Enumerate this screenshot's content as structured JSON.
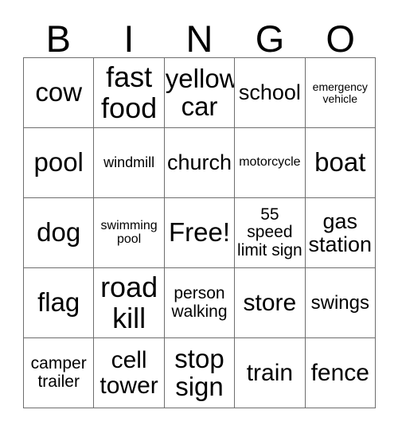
{
  "card": {
    "title": "Bingo Card",
    "headers": [
      "B",
      "I",
      "N",
      "G",
      "O"
    ],
    "colors": {
      "background": "#ffffff",
      "text": "#000000",
      "grid_line": "#6e6e6e"
    },
    "grid": {
      "columns": 5,
      "rows": 5
    },
    "cells": [
      {
        "text": "cow",
        "size": "s-4xl",
        "lines": 1,
        "free": false
      },
      {
        "text": "fast\nfood",
        "size": "s-5xl",
        "lines": 2,
        "free": false
      },
      {
        "text": "yellow\ncar",
        "size": "s-4xl",
        "lines": 2,
        "free": false
      },
      {
        "text": "school",
        "size": "s-xxl",
        "lines": 1,
        "free": false
      },
      {
        "text": "emergency\nvehicle",
        "size": "s-xs",
        "lines": 2,
        "free": false
      },
      {
        "text": "pool",
        "size": "s-4xl",
        "lines": 1,
        "free": false
      },
      {
        "text": "windmill",
        "size": "s-md",
        "lines": 1,
        "free": false
      },
      {
        "text": "church",
        "size": "s-xxl",
        "lines": 1,
        "free": false
      },
      {
        "text": "motorcycle",
        "size": "s-sm",
        "lines": 1,
        "free": false
      },
      {
        "text": "boat",
        "size": "s-4xl",
        "lines": 1,
        "free": false
      },
      {
        "text": "dog",
        "size": "s-4xl",
        "lines": 1,
        "free": false
      },
      {
        "text": "swimming\npool",
        "size": "s-sm",
        "lines": 2,
        "free": false
      },
      {
        "text": "Free!",
        "size": "s-4xl",
        "lines": 1,
        "free": true
      },
      {
        "text": "55 speed\nlimit sign",
        "size": "s-lg",
        "lines": 2,
        "free": false
      },
      {
        "text": "gas\nstation",
        "size": "s-xxl",
        "lines": 2,
        "free": false
      },
      {
        "text": "flag",
        "size": "s-4xl",
        "lines": 1,
        "free": false
      },
      {
        "text": "road\nkill",
        "size": "s-5xl",
        "lines": 2,
        "free": false
      },
      {
        "text": "person\nwalking",
        "size": "s-lg",
        "lines": 2,
        "free": false
      },
      {
        "text": "store",
        "size": "s-3xl",
        "lines": 1,
        "free": false
      },
      {
        "text": "swings",
        "size": "s-xl",
        "lines": 1,
        "free": false
      },
      {
        "text": "camper\ntrailer",
        "size": "s-lg",
        "lines": 2,
        "free": false
      },
      {
        "text": "cell\ntower",
        "size": "s-3xl",
        "lines": 2,
        "free": false
      },
      {
        "text": "stop\nsign",
        "size": "s-4xl",
        "lines": 2,
        "free": false
      },
      {
        "text": "train",
        "size": "s-3xl",
        "lines": 1,
        "free": false
      },
      {
        "text": "fence",
        "size": "s-3xl",
        "lines": 1,
        "free": false
      }
    ]
  }
}
